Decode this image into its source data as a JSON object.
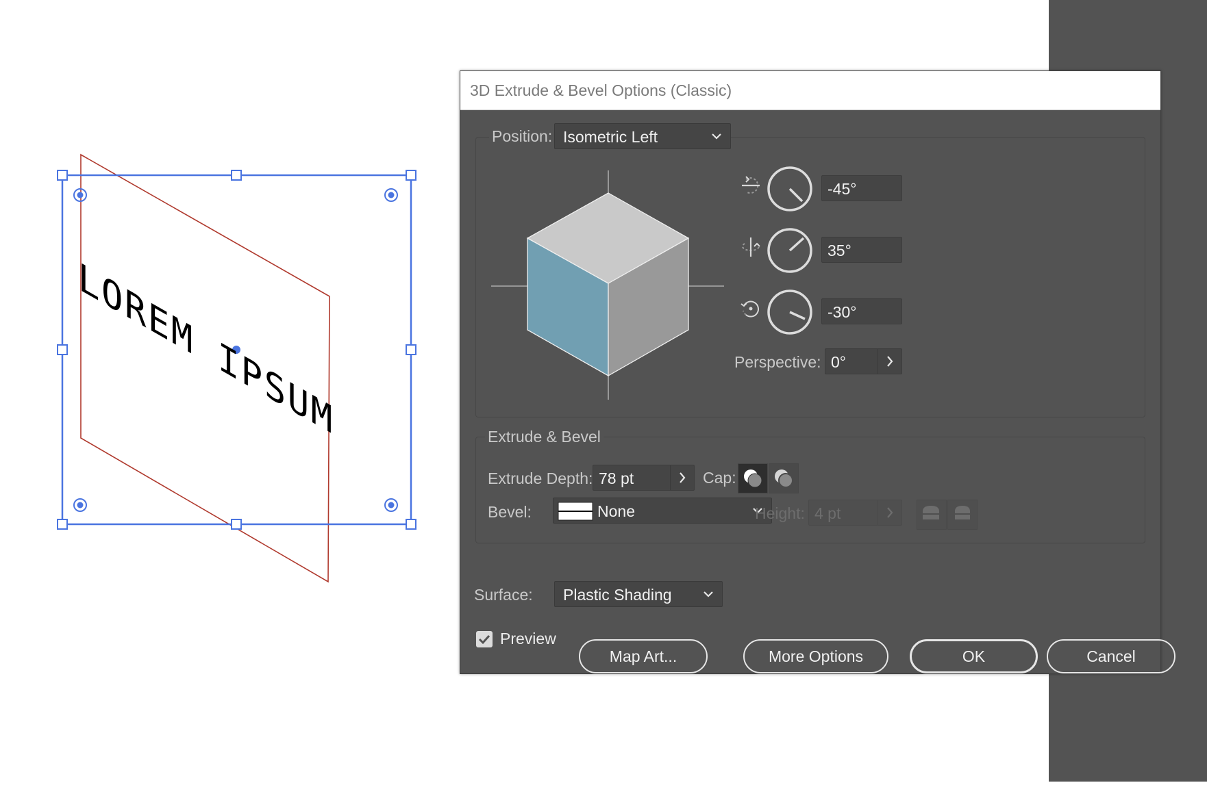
{
  "artwork": {
    "text": "LOREM IPSUM"
  },
  "dialog": {
    "title": "3D Extrude & Bevel Options (Classic)",
    "position": {
      "label": "Position:",
      "value": "Isometric Left"
    },
    "rotation": {
      "x": "-45°",
      "y": "35°",
      "z": "-30°"
    },
    "perspective": {
      "label": "Perspective:",
      "value": "0°"
    },
    "extrude_bevel": {
      "group_label": "Extrude & Bevel",
      "depth_label": "Extrude Depth:",
      "depth_value": "78 pt",
      "cap_label": "Cap:",
      "bevel_label": "Bevel:",
      "bevel_value": "None",
      "height_label": "Height:",
      "height_value": "4 pt"
    },
    "surface": {
      "label": "Surface:",
      "value": "Plastic Shading"
    },
    "preview_label": "Preview",
    "buttons": {
      "map_art": "Map Art...",
      "more_options": "More Options",
      "ok": "OK",
      "cancel": "Cancel"
    }
  },
  "colors": {
    "panel_bg": "#535353",
    "selection_blue": "#4a74e0",
    "guide_red": "#b03a2e",
    "cube_top": "#c9c9c9",
    "cube_left": "#719fb2",
    "cube_right": "#999999"
  }
}
